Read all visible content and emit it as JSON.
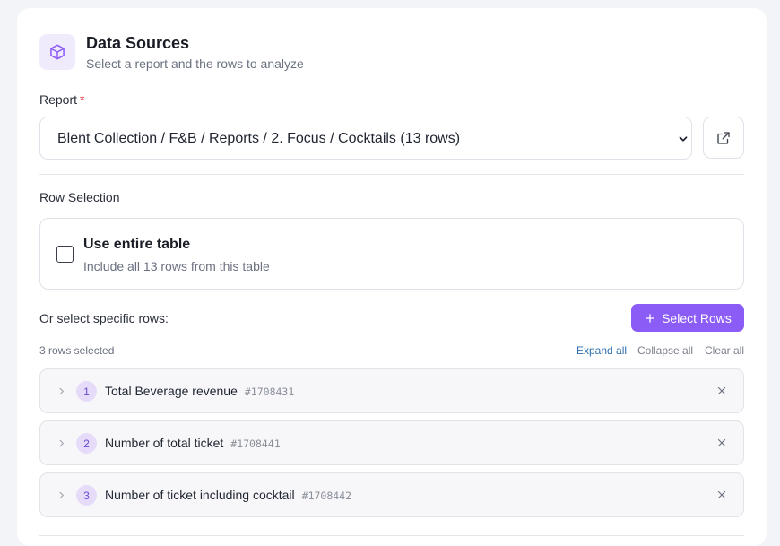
{
  "header": {
    "title": "Data Sources",
    "subtitle": "Select a report and the rows to analyze",
    "icon": "cube-icon"
  },
  "report": {
    "label": "Report",
    "required_mark": "*",
    "selected": "Blent Collection / F&B / Reports / 2. Focus / Cocktails (13 rows)",
    "open_icon": "external-link-icon"
  },
  "row_selection": {
    "label": "Row Selection",
    "entire_table": {
      "title": "Use entire table",
      "subtitle": "Include all 13 rows from this table",
      "checked": false
    },
    "specific_label": "Or select specific rows:",
    "select_button": "Select Rows",
    "count_text": "3 rows selected",
    "expand_all": "Expand all",
    "collapse_all": "Collapse all",
    "clear_all": "Clear all",
    "rows": [
      {
        "index": "1",
        "name": "Total Beverage revenue",
        "id": "#1708431"
      },
      {
        "index": "2",
        "name": "Number of total ticket",
        "id": "#1708441"
      },
      {
        "index": "3",
        "name": "Number of ticket including cocktail",
        "id": "#1708442"
      }
    ]
  },
  "colors": {
    "accent": "#8b5cf6",
    "accent_soft": "#f0ebfc",
    "link": "#2f6fae",
    "required": "#e5484d"
  }
}
